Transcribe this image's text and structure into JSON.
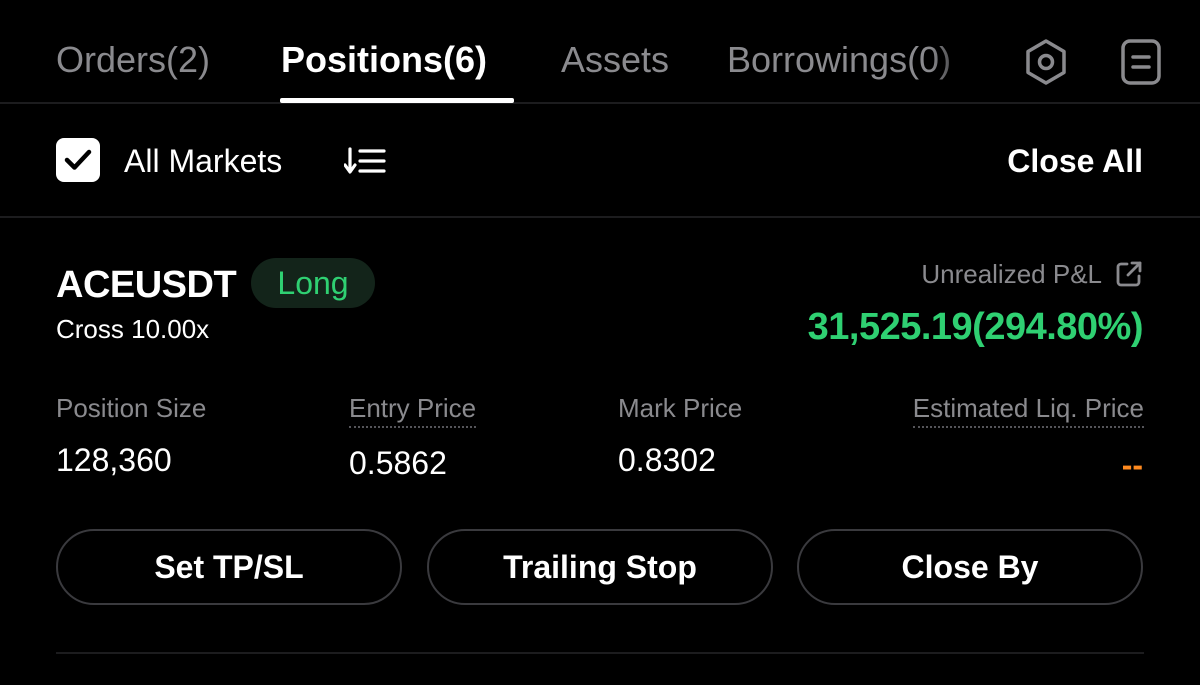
{
  "tabs": {
    "orders": "Orders(2)",
    "positions": "Positions(6)",
    "assets": "Assets",
    "borrowings": "Borrowings(0)"
  },
  "icons": {
    "settings": "settings-hexagon-icon",
    "history": "document-icon",
    "check": "check-icon",
    "sort": "sort-icon",
    "share": "share-external-icon"
  },
  "filter": {
    "all_markets_label": "All Markets",
    "all_markets_checked": true,
    "close_all_label": "Close All"
  },
  "position": {
    "symbol": "ACEUSDT",
    "side": "Long",
    "margin_mode": "Cross 10.00x",
    "pnl_label": "Unrealized P&L",
    "pnl_value": "31,525.19(294.80%)",
    "stats": {
      "size_label": "Position Size",
      "size_value": "128,360",
      "entry_label": "Entry Price",
      "entry_value": "0.5862",
      "mark_label": "Mark Price",
      "mark_value": "0.8302",
      "liq_label": "Estimated Liq. Price",
      "liq_value": "--"
    },
    "actions": {
      "tpsl": "Set TP/SL",
      "trailing": "Trailing Stop",
      "close_by": "Close By"
    }
  },
  "colors": {
    "background": "#000000",
    "profit_green": "#2fd072",
    "badge_bg": "#13241a",
    "liq_orange": "#ff8a1f",
    "muted_text": "#8a8a8e"
  }
}
